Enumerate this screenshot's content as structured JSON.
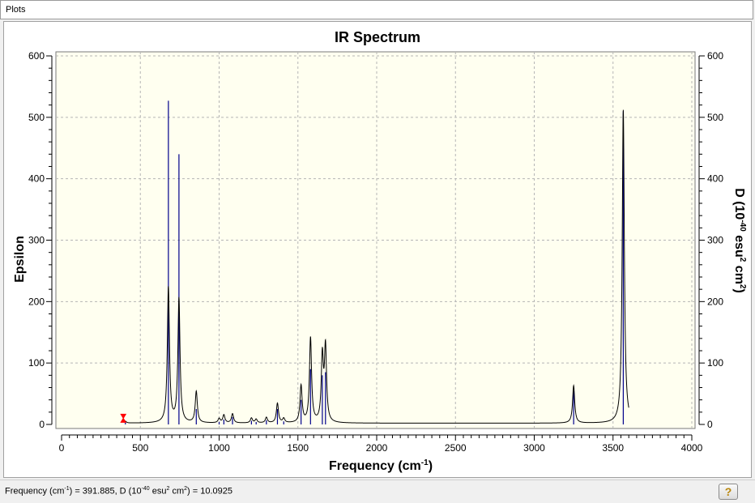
{
  "window": {
    "title": "Plots"
  },
  "status": {
    "freq_label": "Frequency (cm",
    "freq_sup": "-1",
    "freq_close": ") = ",
    "freq_value": "391.885",
    "d_label": ", D (10",
    "d_sup1": "-40",
    "d_unit": " esu",
    "d_sup2": "2",
    "d_unit2": " cm",
    "d_sup3": "2",
    "d_close": ") = ",
    "d_value": "10.0925"
  },
  "help_button": {
    "icon": "help-icon"
  },
  "colors": {
    "plot_bg": "#fffff0",
    "spectrum_line": "#000000",
    "stick_color": "#00008b",
    "grid_color": "#b5b5b5",
    "marker_color": "#ff0000"
  },
  "chart_data": {
    "type": "line",
    "title": "IR Spectrum",
    "xlabel": "Frequency (cm-1)",
    "xlabel_main": "Frequency (cm",
    "xlabel_sup": "-1",
    "xlabel_end": ")",
    "ylabel": "Epsilon",
    "y2label": "D (10-40 esu2 cm2)",
    "y2label_parts": [
      "D (10",
      "-40",
      " esu",
      "2",
      " cm",
      "2",
      ")"
    ],
    "xlim": [
      0,
      4000
    ],
    "ylim": [
      0,
      600
    ],
    "y2lim": [
      0,
      600
    ],
    "xticks": [
      0,
      500,
      1000,
      1500,
      2000,
      2500,
      3000,
      3500,
      4000
    ],
    "yticks": [
      0,
      100,
      200,
      300,
      400,
      500,
      600
    ],
    "y2ticks": [
      0,
      100,
      200,
      300,
      400,
      500,
      600
    ],
    "grid": true,
    "spectrum_range": [
      400,
      3600
    ],
    "peaks": [
      {
        "x": 405,
        "epsilon": 3,
        "d": 3
      },
      {
        "x": 678,
        "epsilon": 220,
        "d": 527
      },
      {
        "x": 745,
        "epsilon": 202,
        "d": 440
      },
      {
        "x": 855,
        "epsilon": 51,
        "d": 25
      },
      {
        "x": 1000,
        "epsilon": 7,
        "d": 4
      },
      {
        "x": 1030,
        "epsilon": 13,
        "d": 8
      },
      {
        "x": 1085,
        "epsilon": 15,
        "d": 12
      },
      {
        "x": 1205,
        "epsilon": 8,
        "d": 6
      },
      {
        "x": 1235,
        "epsilon": 6,
        "d": 4
      },
      {
        "x": 1300,
        "epsilon": 9,
        "d": 7
      },
      {
        "x": 1370,
        "epsilon": 32,
        "d": 25
      },
      {
        "x": 1410,
        "epsilon": 7,
        "d": 5
      },
      {
        "x": 1520,
        "epsilon": 60,
        "d": 40
      },
      {
        "x": 1580,
        "epsilon": 138,
        "d": 90
      },
      {
        "x": 1655,
        "epsilon": 105,
        "d": 80
      },
      {
        "x": 1675,
        "epsilon": 120,
        "d": 85
      },
      {
        "x": 3250,
        "epsilon": 61,
        "d": 55
      },
      {
        "x": 3565,
        "epsilon": 510,
        "d": 510
      }
    ],
    "cursor": {
      "x": 391.885,
      "d": 10.0925
    }
  }
}
